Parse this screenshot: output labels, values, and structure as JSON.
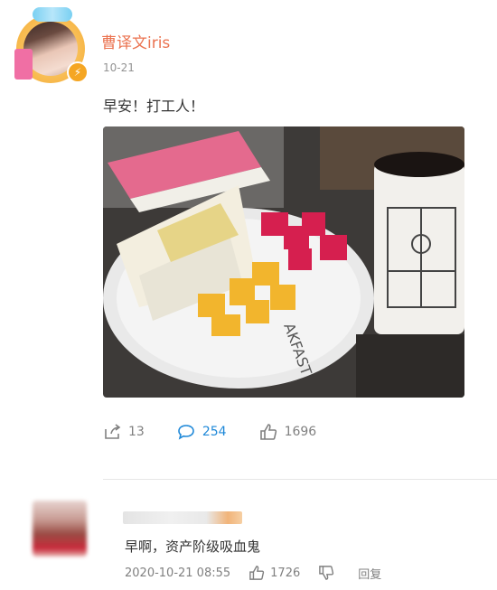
{
  "post": {
    "author": "曹译文iris",
    "time": "10-21",
    "text": "早安！打工人！",
    "image_alt": "早餐：三明治、火龙果、黄桃与一杯咖啡"
  },
  "actions": {
    "share_count": "13",
    "comment_count": "254",
    "like_count": "1696"
  },
  "comment": {
    "text": "早啊，资产阶级吸血鬼",
    "time": "2020-10-21 08:55",
    "like_count": "1726",
    "reply_label": "回复"
  },
  "colors": {
    "username": "#eb7350",
    "active_blue": "#1e88d8",
    "meta_gray": "#808080"
  },
  "icons": [
    "share-icon",
    "comment-icon",
    "like-icon",
    "dislike-icon",
    "verified-icon"
  ]
}
